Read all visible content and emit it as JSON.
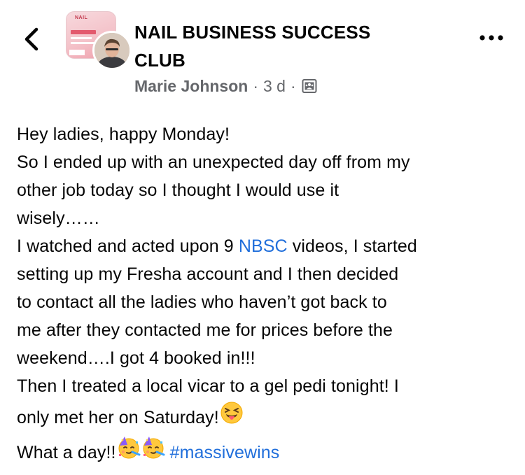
{
  "header": {
    "back_icon": "chevron-left-icon",
    "group_name_line1": "NAIL BUSINESS SUCCESS",
    "group_name_line2": "CLUB",
    "group_thumb_text": "NAIL",
    "author": "Marie Johnson",
    "separator": "·",
    "time": "3 d",
    "audience_icon": "group-members-icon",
    "more_icon": "more-horizontal-icon"
  },
  "post": {
    "line1": "Hey ladies, happy Monday!",
    "line2": "So I ended up with an unexpected day off from my",
    "line3": "other job today so I thought I would use it",
    "line4": "wisely……",
    "line5_pre": "I watched and acted upon 9 ",
    "line5_link": "NBSC",
    "line5_post": " videos, I started",
    "line6": "setting up my Fresha account and I then decided",
    "line7": "to contact all the ladies who haven’t got back to",
    "line8": "me after they contacted me for prices before the",
    "line9": "weekend….I got 4 booked in!!!",
    "line10": "Then I treated a local vicar to a gel pedi tonight! I",
    "line11": "only met her on Saturday!",
    "line12_pre": "What a day!!",
    "hashtag": "#massivewins",
    "emoji_tongue": "squinting-tongue-face-emoji",
    "emoji_party": "partying-face-emoji"
  },
  "colors": {
    "link": "#216fdb",
    "meta": "#65676b",
    "text": "#050505"
  }
}
